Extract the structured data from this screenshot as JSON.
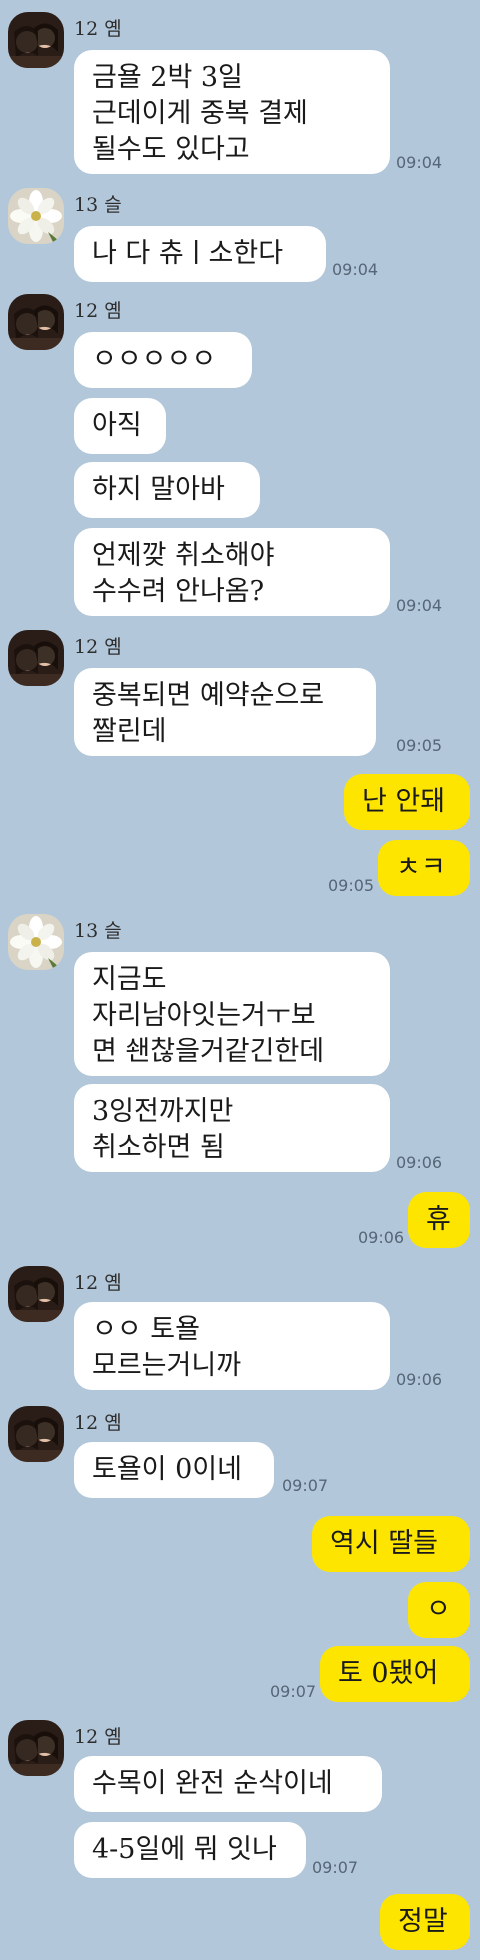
{
  "senders": {
    "a": "12 옘",
    "b": "13 슬"
  },
  "messages": {
    "m1": "금욜 2박 3일\n근데이게 중복 결제\n될수도 있다고",
    "m2": "나 다 츄ㅣ소한다",
    "m3": "ㅇㅇㅇㅇㅇ",
    "m4": "아직",
    "m5": "하지 말아바",
    "m6": "언제깢 취소해야\n수수려 안나옴?",
    "m7": "중복되면 예약순으로\n짤린데",
    "m8": "난 안돼",
    "m9": "ㅊㅋ",
    "m10": "지금도\n자리남아잇는거ㅜ보\n면 쇈찮을거같긴한데",
    "m11": "3잉전까지만\n취소하면 됨",
    "m12": "휴",
    "m13": "ㅇㅇ 토욜\n모르는거니까",
    "m14": "토욜이 0이네",
    "m15": "역시 딸들",
    "m16": "ㅇ",
    "m17": "토 0됐어",
    "m18": "수목이 완전 순삭이네",
    "m19": "4-5일에 뭐 잇나",
    "m20": "정말"
  },
  "times": {
    "t1": "09:04",
    "t2": "09:04",
    "t3": "09:04",
    "t4": "09:05",
    "t5": "09:05",
    "t6": "09:06",
    "t7": "09:06",
    "t8": "09:06",
    "t9": "09:07",
    "t10": "09:07",
    "t11": "09:07"
  },
  "colors": {
    "background": "#b2c7da",
    "incoming_bubble": "#ffffff",
    "outgoing_bubble": "#fee500"
  }
}
